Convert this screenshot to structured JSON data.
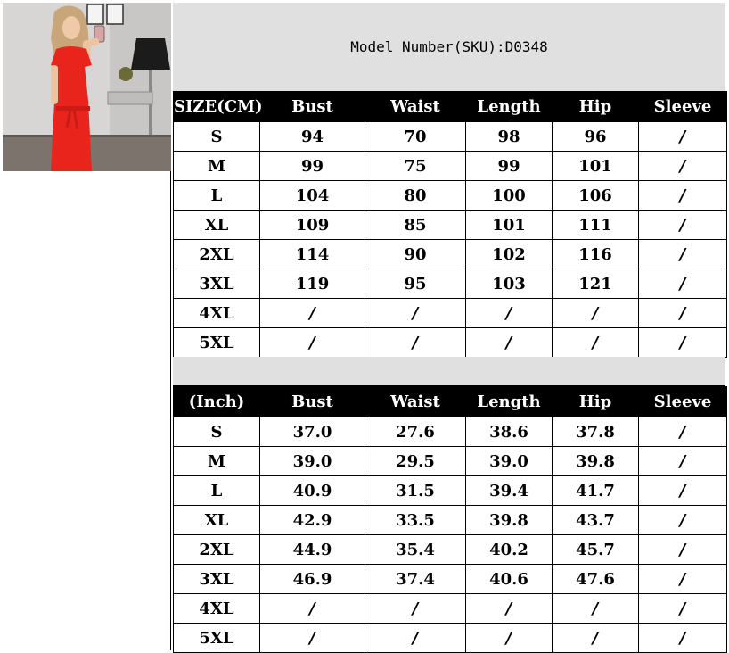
{
  "header": {
    "model_number": "Model Number(SKU):D0348"
  },
  "photo": {
    "icon": "model-photo",
    "accent": "#e8241c"
  },
  "cm_table": {
    "columns": [
      "SIZE(CM)",
      "Bust",
      "Waist",
      "Length",
      "Hip",
      "Sleeve"
    ],
    "rows": [
      [
        "S",
        "94",
        "70",
        "98",
        "96",
        "/"
      ],
      [
        "M",
        "99",
        "75",
        "99",
        "101",
        "/"
      ],
      [
        "L",
        "104",
        "80",
        "100",
        "106",
        "/"
      ],
      [
        "XL",
        "109",
        "85",
        "101",
        "111",
        "/"
      ],
      [
        "2XL",
        "114",
        "90",
        "102",
        "116",
        "/"
      ],
      [
        "3XL",
        "119",
        "95",
        "103",
        "121",
        "/"
      ],
      [
        "4XL",
        "/",
        "/",
        "/",
        "/",
        "/"
      ],
      [
        "5XL",
        "/",
        "/",
        "/",
        "/",
        "/"
      ]
    ]
  },
  "inch_table": {
    "columns": [
      "(Inch)",
      "Bust",
      "Waist",
      "Length",
      "Hip",
      "Sleeve"
    ],
    "rows": [
      [
        "S",
        "37.0",
        "27.6",
        "38.6",
        "37.8",
        "/"
      ],
      [
        "M",
        "39.0",
        "29.5",
        "39.0",
        "39.8",
        "/"
      ],
      [
        "L",
        "40.9",
        "31.5",
        "39.4",
        "41.7",
        "/"
      ],
      [
        "XL",
        "42.9",
        "33.5",
        "39.8",
        "43.7",
        "/"
      ],
      [
        "2XL",
        "44.9",
        "35.4",
        "40.2",
        "45.7",
        "/"
      ],
      [
        "3XL",
        "46.9",
        "37.4",
        "40.6",
        "47.6",
        "/"
      ],
      [
        "4XL",
        "/",
        "/",
        "/",
        "/",
        "/"
      ],
      [
        "5XL",
        "/",
        "/",
        "/",
        "/",
        "/"
      ]
    ]
  }
}
